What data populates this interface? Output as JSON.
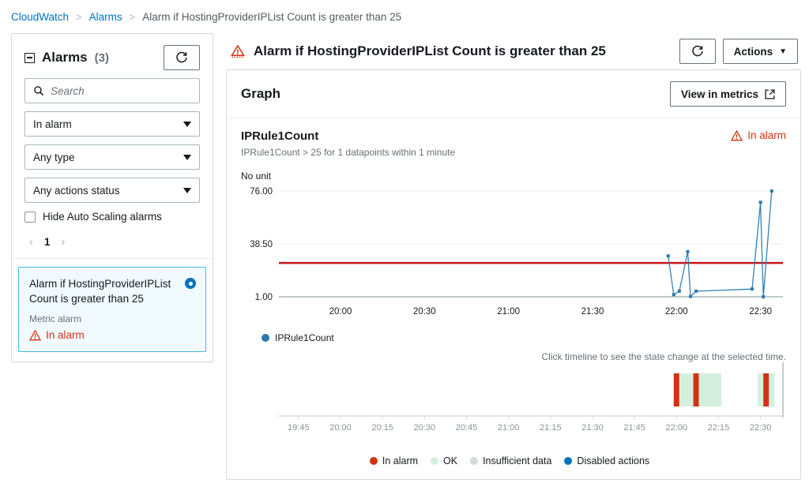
{
  "breadcrumb": {
    "items": [
      {
        "label": "CloudWatch",
        "link": true
      },
      {
        "label": "Alarms",
        "link": true
      },
      {
        "label": "Alarm if HostingProviderIPList Count is greater than 25",
        "link": false
      }
    ],
    "separator": ">"
  },
  "sidebar": {
    "title": "Alarms",
    "count": "(3)",
    "refresh_icon": "refresh-icon",
    "search": {
      "placeholder": "Search",
      "value": "",
      "icon": "search-icon"
    },
    "filters": [
      {
        "name": "state-filter",
        "value": "In alarm"
      },
      {
        "name": "type-filter",
        "value": "Any type"
      },
      {
        "name": "actions-status-filter",
        "value": "Any actions status"
      }
    ],
    "checkbox": {
      "label": "Hide Auto Scaling alarms",
      "checked": false
    },
    "pagination": {
      "prev": "‹",
      "page": "1",
      "next": "›"
    },
    "alarm_card": {
      "name": "Alarm if HostingProviderIPList Count is greater than 25",
      "type": "Metric alarm",
      "state": "In alarm",
      "selected": true
    }
  },
  "main": {
    "title": "Alarm if HostingProviderIPList Count is greater than 25",
    "state_icon": "warning-triangle-icon",
    "refresh_icon": "refresh-icon",
    "actions_label": "Actions",
    "actions_caret": "▼",
    "panel_title": "Graph",
    "view_in_metrics_label": "View in metrics",
    "view_in_metrics_icon": "external-link-icon"
  },
  "graph": {
    "metric_name": "IPRule1Count",
    "condition": "IPRule1Count > 25 for 1 datapoints within 1 minute",
    "state": "In alarm",
    "unit_label": "No unit",
    "legend_series": "IPRule1Count",
    "hint": "Click timeline to see the state change at the selected time."
  },
  "timeline_legend": [
    {
      "label": "In alarm",
      "color": "#d13212"
    },
    {
      "label": "OK",
      "color": "#d5efdf"
    },
    {
      "label": "Insufficient data",
      "color": "#d5dbdb"
    },
    {
      "label": "Disabled actions",
      "color": "#0073bb"
    }
  ],
  "colors": {
    "link": "#0073bb",
    "alarm_red": "#d13212",
    "threshold_red": "#c7161b",
    "series_blue": "#2a7ab0",
    "ok_green": "#d5efdf",
    "border": "#d5dbdb",
    "selected_border": "#44b9d6",
    "selected_bg": "#f1faff"
  },
  "chart_data": {
    "type": "line",
    "title": "IPRule1Count",
    "xlabel": "",
    "ylabel": "No unit",
    "ylim": [
      1.0,
      76.0
    ],
    "yticks": [
      1.0,
      38.5,
      76.0
    ],
    "ytick_labels": [
      "1.00",
      "38.50",
      "76.00"
    ],
    "xticks": [
      "20:00",
      "20:30",
      "21:00",
      "21:30",
      "22:00",
      "22:30"
    ],
    "xlim": [
      "19:38",
      "22:38"
    ],
    "grid": true,
    "legend_position": "bottom-left",
    "threshold": {
      "value": 25,
      "label": "IPRule1Count > 25",
      "color": "#c7161b"
    },
    "series": [
      {
        "name": "IPRule1Count",
        "color": "#2a7ab0",
        "points": [
          {
            "t": "21:57",
            "v": 30.0
          },
          {
            "t": "21:59",
            "v": 2.5
          },
          {
            "t": "22:01",
            "v": 5.0
          },
          {
            "t": "22:04",
            "v": 33.0
          },
          {
            "t": "22:05",
            "v": 1.2
          },
          {
            "t": "22:07",
            "v": 5.0
          },
          {
            "t": "22:27",
            "v": 6.5
          },
          {
            "t": "22:30",
            "v": 68.0
          },
          {
            "t": "22:31",
            "v": 1.0
          },
          {
            "t": "22:34",
            "v": 76.0
          }
        ]
      }
    ],
    "timeline": {
      "xticks": [
        "19:45",
        "20:00",
        "20:15",
        "20:30",
        "20:45",
        "21:00",
        "21:15",
        "21:30",
        "21:45",
        "22:00",
        "22:15",
        "22:30"
      ],
      "segments": [
        {
          "state": "In alarm",
          "start": "21:59",
          "end": "22:01",
          "color": "#d13212"
        },
        {
          "state": "OK",
          "start": "22:01",
          "end": "22:06",
          "color": "#d5efdf"
        },
        {
          "state": "In alarm",
          "start": "22:06",
          "end": "22:08",
          "color": "#d13212"
        },
        {
          "state": "OK",
          "start": "22:08",
          "end": "22:16",
          "color": "#d5efdf"
        },
        {
          "state": "OK",
          "start": "22:29",
          "end": "22:31",
          "color": "#d5efdf"
        },
        {
          "state": "In alarm",
          "start": "22:31",
          "end": "22:33",
          "color": "#d13212"
        },
        {
          "state": "OK",
          "start": "22:33",
          "end": "22:35",
          "color": "#d5efdf"
        }
      ]
    }
  }
}
